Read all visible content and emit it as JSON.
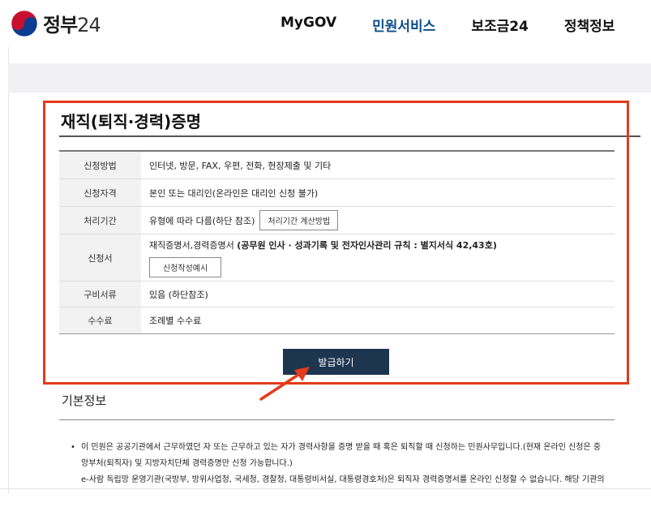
{
  "header": {
    "logo_text": "정부",
    "logo_number": "24",
    "nav": [
      "MyGOV",
      "민원서비스",
      "보조금24",
      "정책정보"
    ],
    "active_nav": "민원서비스",
    "accent_color": "#0b4f8a"
  },
  "main": {
    "title": "재직(퇴직·경력)증명",
    "rows": [
      {
        "label": "신청방법",
        "value": "인터넷, 방문, FAX, 우편, 전화, 현장제출 및 기타"
      },
      {
        "label": "신청자격",
        "value": "본인 또는 대리인(온라인은 대리인 신청 불가)"
      },
      {
        "label": "처리기간",
        "value": "유형에 따라 다름(하단 참조)",
        "button": "처리기간 계산방법"
      },
      {
        "label": "신청서",
        "value_plain": "재직증명서,경력증명서 ",
        "value_bold": "(공무원 인사 · 성과기록 및 전자인사관리 규칙 : 별지서식 42,43호)",
        "button": "신청작성예시"
      },
      {
        "label": "구비서류",
        "value": "있음 (하단참조)"
      },
      {
        "label": "수수료",
        "value": "조례별 수수료"
      }
    ],
    "issue_button": "발급하기",
    "highlight_color": "#e23b1b",
    "button_color": "#1e3550"
  },
  "info": {
    "title": "기본정보",
    "bullet": "•",
    "lines": [
      "이 민원은 공공기관에서 근무하였던 자 또는 근무하고 있는 자가 경력사항을 증명 받을 때 혹은 퇴직할 때 신청하는 민원사무입니다.(현재 온라인 신청은 중",
      "앙부처(퇴직자) 및 지방자치단체 경력증명만 신청 가능합니다.)",
      "e-사람 독립망 운영기관(국방부, 방위사업청, 국세청, 경찰청, 대통령비서실, 대통령경호처)은 퇴직자 경력증명서를 온라인 신청할 수 없습니다. 해당 기관의"
    ]
  }
}
